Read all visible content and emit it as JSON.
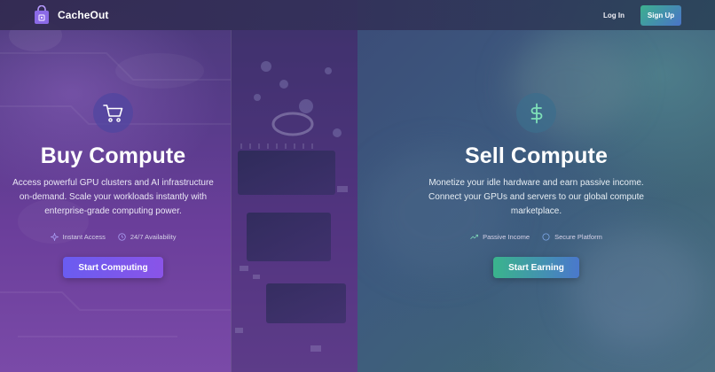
{
  "brand": {
    "name": "CacheOut"
  },
  "nav": {
    "login_label": "Log In",
    "signup_label": "Sign Up"
  },
  "buy": {
    "icon": "shopping-cart-icon",
    "title": "Buy Compute",
    "description": "Access powerful GPU clusters and AI infrastructure on-demand. Scale your workloads instantly with enterprise-grade computing power.",
    "features": [
      {
        "icon": "sparkle-icon",
        "label": "Instant Access"
      },
      {
        "icon": "clock-icon",
        "label": "24/7 Availability"
      }
    ],
    "cta_label": "Start Computing"
  },
  "sell": {
    "icon": "dollar-icon",
    "title": "Sell Compute",
    "description": "Monetize your idle hardware and earn passive income. Connect your GPUs and servers to our global compute marketplace.",
    "features": [
      {
        "icon": "trending-up-icon",
        "label": "Passive Income"
      },
      {
        "icon": "shield-icon",
        "label": "Secure Platform"
      }
    ],
    "cta_label": "Start Earning"
  },
  "colors": {
    "buy_accent": "#6a5cf0",
    "sell_accent": "#3ab48c",
    "signup_gradient_start": "#3cb08e",
    "signup_gradient_end": "#4a73c8"
  }
}
